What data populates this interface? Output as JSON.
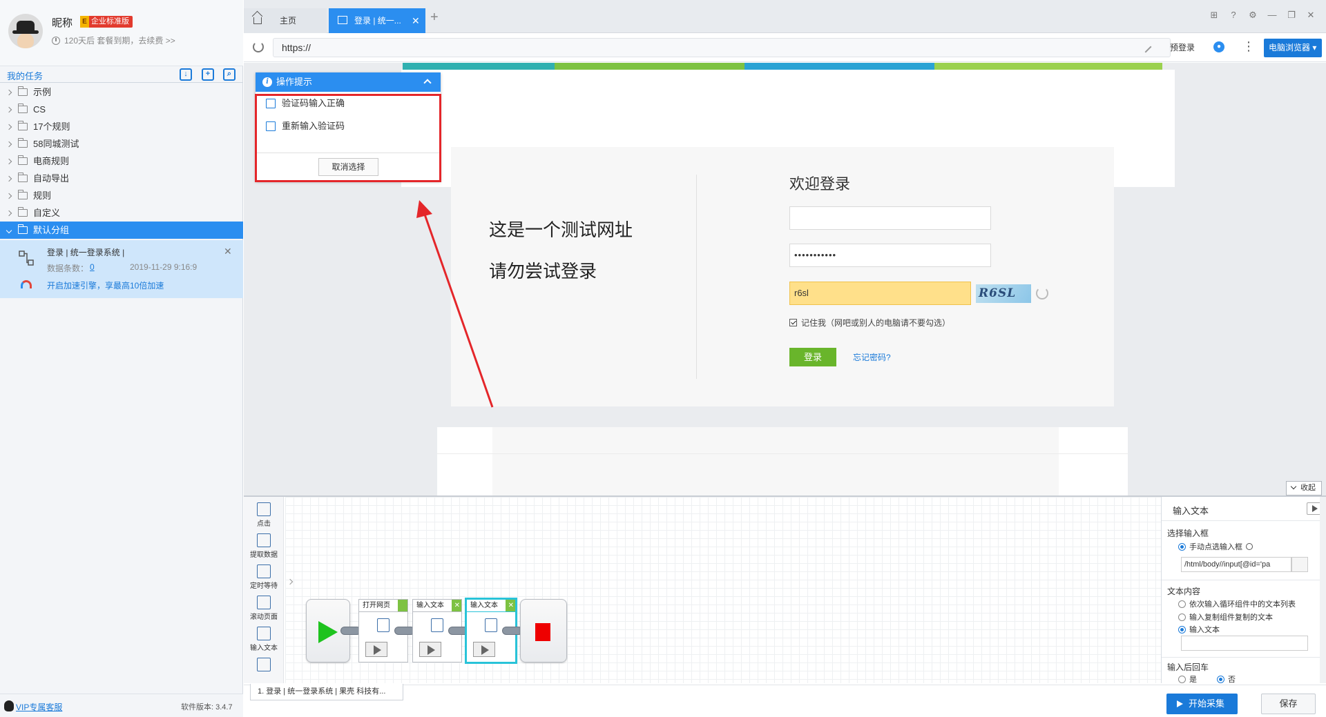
{
  "profile": {
    "nickname": "昵称",
    "edition_letter": "E",
    "edition": "企业标准版",
    "expiry_text": "120天后 套餐到期，去续费 >>"
  },
  "tasks": {
    "title": "我的任务",
    "items": [
      {
        "label": "示例"
      },
      {
        "label": "CS"
      },
      {
        "label": "17个规则"
      },
      {
        "label": "58同城测试"
      },
      {
        "label": "电商规则"
      },
      {
        "label": "自动导出"
      },
      {
        "label": "规则"
      },
      {
        "label": "自定义"
      },
      {
        "label": "默认分组"
      }
    ],
    "current": {
      "name": "登录 | 统一登录系统 |",
      "count_label": "数据条数：",
      "count": "0",
      "date": "2019-11-29 9:16:9",
      "speed_text": "开启加速引擎，享最高10倍加速"
    }
  },
  "footer": {
    "vip": "VIP专属客服",
    "version": "软件版本: 3.4.7"
  },
  "tabs": {
    "home": "主页",
    "login": "登录 | 统一...",
    "add": "+"
  },
  "address": {
    "url": "https://",
    "prelogin": "预登录",
    "browser_mode": "电脑浏览器 ▾"
  },
  "page": {
    "notice_line1": "这是一个测试网址",
    "notice_line2": "请勿尝试登录",
    "welcome": "欢迎登录",
    "password_dots": "•••••••••••",
    "captcha_value": "r6sl",
    "captcha_image_text": "R6SL",
    "remember_text": "记住我（网吧或别人的电脑请不要勾选）",
    "login_button": "登录",
    "forgot": "忘记密码?"
  },
  "tips": {
    "title": "操作提示",
    "option1": "验证码输入正确",
    "option2": "重新输入验证码",
    "cancel": "取消选择"
  },
  "designer": {
    "collapse": "收起",
    "palette": [
      {
        "label": "点击"
      },
      {
        "label": "提取数据"
      },
      {
        "label": "定时等待"
      },
      {
        "label": "滚动页面"
      },
      {
        "label": "输入文本"
      }
    ],
    "steps": [
      {
        "label": "打开网页"
      },
      {
        "label": "输入文本"
      },
      {
        "label": "输入文本"
      }
    ],
    "flow_tab": "1. 登录 | 统一登录系统 | 果壳 科技有...",
    "start": "开始采集",
    "save": "保存"
  },
  "props": {
    "title": "输入文本",
    "select_input_label": "选择输入框",
    "manual_select": "手动点选输入框",
    "xpath": "/html/body//input[@id='pa",
    "text_content_label": "文本内容",
    "opt_loop": "依次输入循环组件中的文本列表",
    "opt_copy": "输入复制组件复制的文本",
    "opt_text": "输入文本",
    "enter_label": "输入后回车",
    "yes": "是",
    "no": "否"
  },
  "colors": {
    "accent": "#2b8ef0",
    "highlight": "#e4262a",
    "login_green": "#69b52b"
  }
}
